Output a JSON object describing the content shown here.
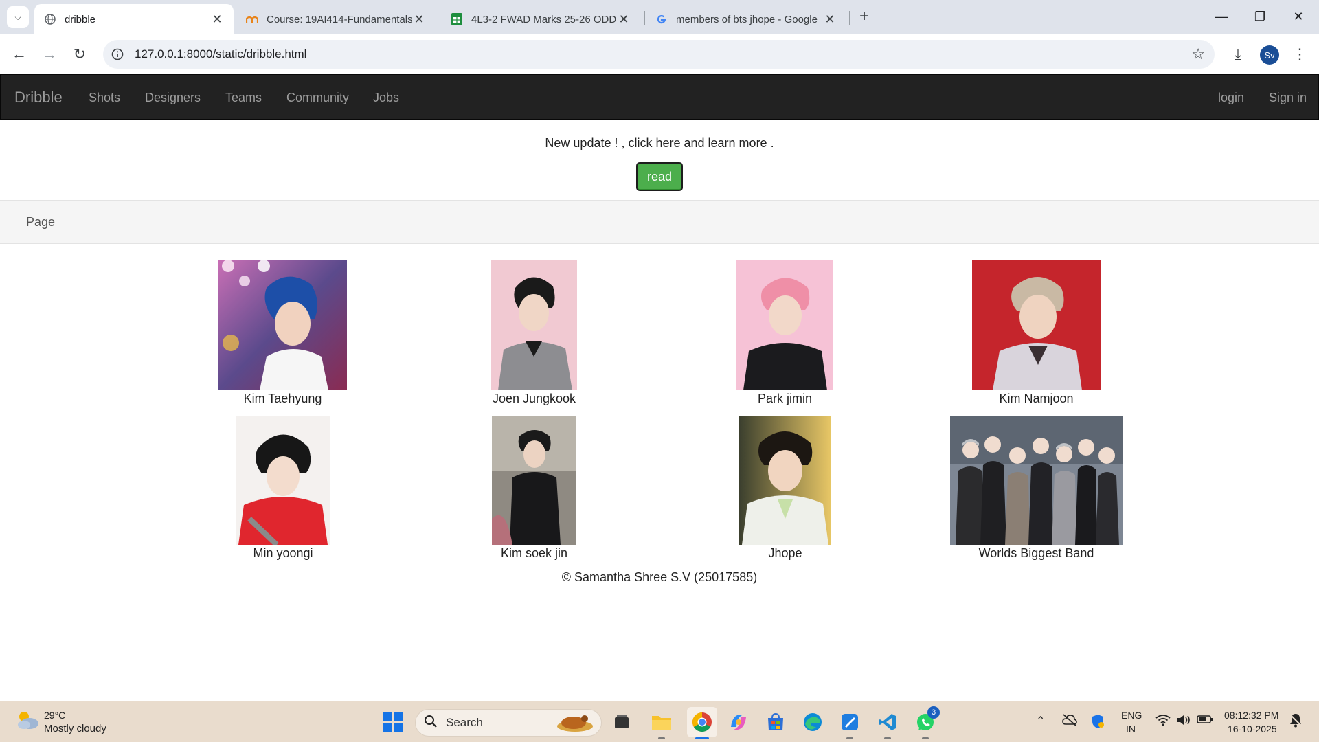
{
  "browser": {
    "tabs": [
      {
        "title": "dribble",
        "favicon": "globe-icon",
        "active": true
      },
      {
        "title": "Course: 19AI414-Fundamentals",
        "favicon": "moodle-icon",
        "active": false
      },
      {
        "title": "4L3-2 FWAD Marks 25-26 ODD",
        "favicon": "sheets-icon",
        "active": false
      },
      {
        "title": "members of bts jhope - Google",
        "favicon": "google-icon",
        "active": false
      }
    ],
    "url": "127.0.0.1:8000/static/dribble.html",
    "profile_initials": "Sv"
  },
  "site": {
    "brand": "Dribble",
    "nav_links": [
      "Shots",
      "Designers",
      "Teams",
      "Community",
      "Jobs"
    ],
    "nav_right": [
      "login",
      "Sign in"
    ],
    "announcement": "New update ! , click here and learn more .",
    "read_button": "read",
    "page_label": "Page",
    "members": [
      {
        "name": "Kim Taehyung"
      },
      {
        "name": "Joen Jungkook"
      },
      {
        "name": "Park jimin"
      },
      {
        "name": "Kim Namjoon"
      },
      {
        "name": "Min yoongi"
      },
      {
        "name": "Kim soek jin"
      },
      {
        "name": "Jhope"
      },
      {
        "name": "Worlds Biggest Band"
      }
    ],
    "footer": "© Samantha Shree S.V (25017585)"
  },
  "taskbar": {
    "temperature": "29°C",
    "weather": "Mostly cloudy",
    "search_label": "Search",
    "language": "ENG",
    "region": "IN",
    "time": "08:12:32 PM",
    "date": "16-10-2025",
    "whatsapp_badge": "3"
  },
  "colors": {
    "navbar_bg": "#222222",
    "read_button": "#4cae4c",
    "tabstrip": "#dfe3eb",
    "taskbar": "#e9dccd"
  }
}
